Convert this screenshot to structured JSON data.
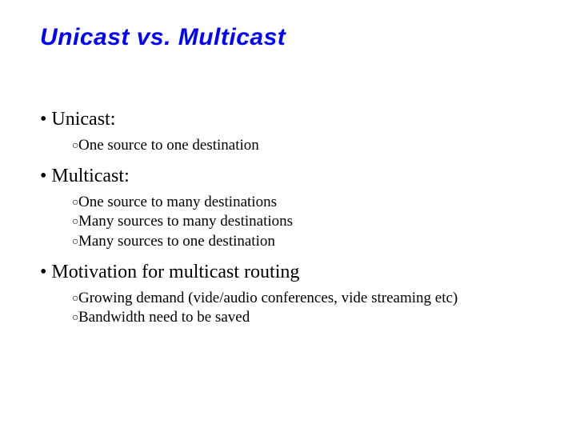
{
  "title": "Unicast vs. Multicast",
  "bullets": [
    {
      "text": "Unicast:",
      "sub": [
        "One source to one destination"
      ]
    },
    {
      "text": "Multicast:",
      "sub": [
        "One source to many destinations",
        "Many sources to many destinations",
        "Many sources to one destination"
      ]
    },
    {
      "text": "Motivation for multicast routing",
      "sub": [
        "Growing demand (vide/audio conferences, vide streaming etc)",
        "Bandwidth need to be saved"
      ]
    }
  ]
}
